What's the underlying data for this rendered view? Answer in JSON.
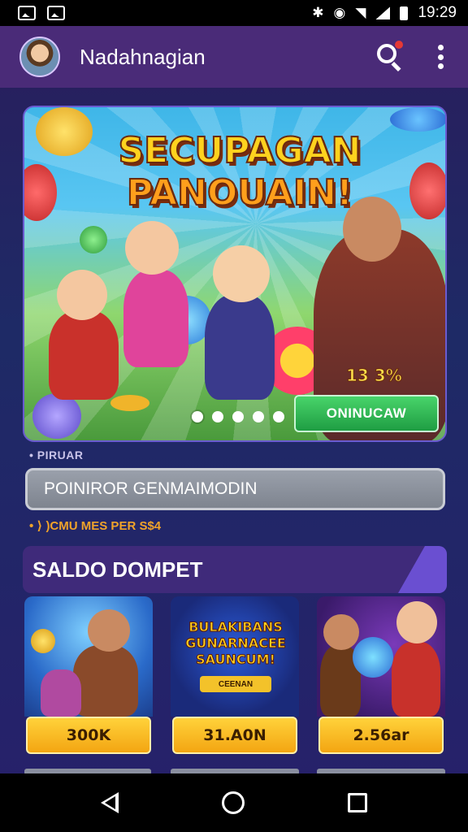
{
  "status_bar": {
    "time": "19:29"
  },
  "app_bar": {
    "title": "Nadahnagian"
  },
  "banner": {
    "title_line1": "SECUPAGAN",
    "title_line2": "PANOUAIN!",
    "percent": "13 3%",
    "cta_label": "ONINUCAW",
    "slide_count": 5,
    "active_slide": 0
  },
  "promo": {
    "label": "• PIRUAR",
    "input_value": "POINIROR GENMAIMODIN",
    "rate_text": "• ⟩ )CMU MES PER S$4"
  },
  "wallet": {
    "title": "SALDO DOMPET",
    "cards": [
      {
        "button_label": "300K"
      },
      {
        "art_title": "BULAKIBANS GUNARNACEE SAUNCUM!",
        "art_sub": "CEENAN",
        "button_label": "31.A0N"
      },
      {
        "button_label": "2.56ar"
      }
    ]
  },
  "colors": {
    "app_bar": "#4a2b78",
    "cta_green": "#1f9d43",
    "gold": "#f3a512",
    "background": "#1e2a66"
  }
}
